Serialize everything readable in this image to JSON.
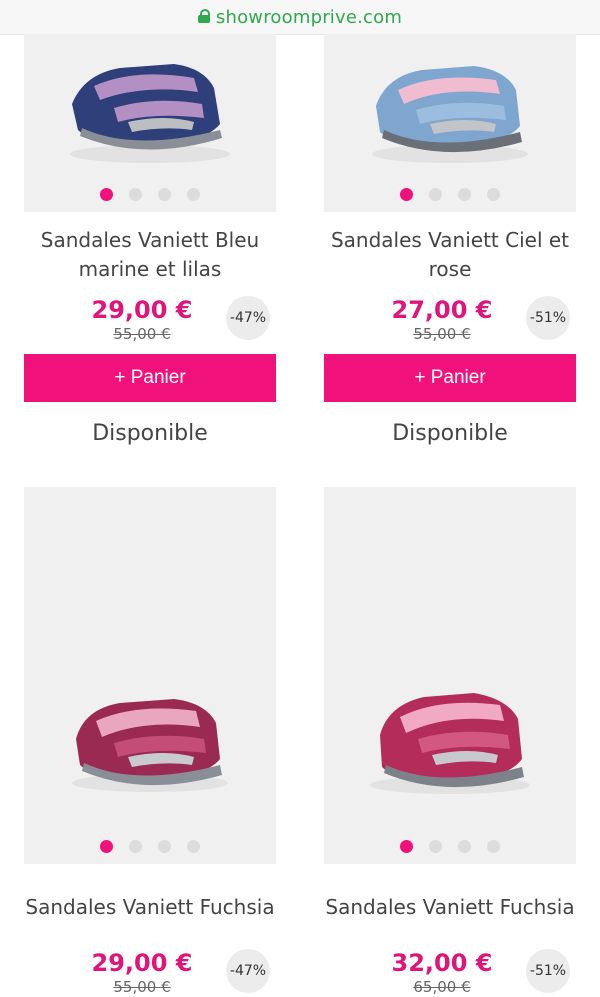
{
  "browser": {
    "domain": "showroomprive.com",
    "lock_icon": "lock-icon"
  },
  "products": [
    {
      "name": "Sandales Vaniett Bleu marine et lilas",
      "price": "29,00 €",
      "old_price": "55,00 €",
      "discount": "-47%",
      "cart_label": "+ Panier",
      "availability": "Disponible",
      "colors": {
        "main": "#2e3f7a",
        "accent": "#b48fc3",
        "sole": "#8a8e96"
      }
    },
    {
      "name": "Sandales Vaniett Ciel et rose",
      "price": "27,00 €",
      "old_price": "55,00 €",
      "discount": "-51%",
      "cart_label": "+ Panier",
      "availability": "Disponible",
      "colors": {
        "main": "#7fa6cf",
        "accent": "#f0bcd0",
        "sole": "#6b6f78"
      }
    },
    {
      "name": "Sandales Vaniett Fuchsia",
      "price": "29,00 €",
      "old_price": "55,00 €",
      "discount": "-47%",
      "colors": {
        "main": "#9b2a52",
        "accent": "#e8a7bf",
        "sole": "#8a8e96"
      }
    },
    {
      "name": "Sandales Vaniett Fuchsia",
      "price": "32,00 €",
      "old_price": "65,00 €",
      "discount": "-51%",
      "colors": {
        "main": "#b32c5a",
        "accent": "#f2a9c4",
        "sole": "#7d8189"
      }
    }
  ],
  "colors": {
    "accent": "#f0127a",
    "price": "#e0157a",
    "secure": "#2fa84f"
  }
}
